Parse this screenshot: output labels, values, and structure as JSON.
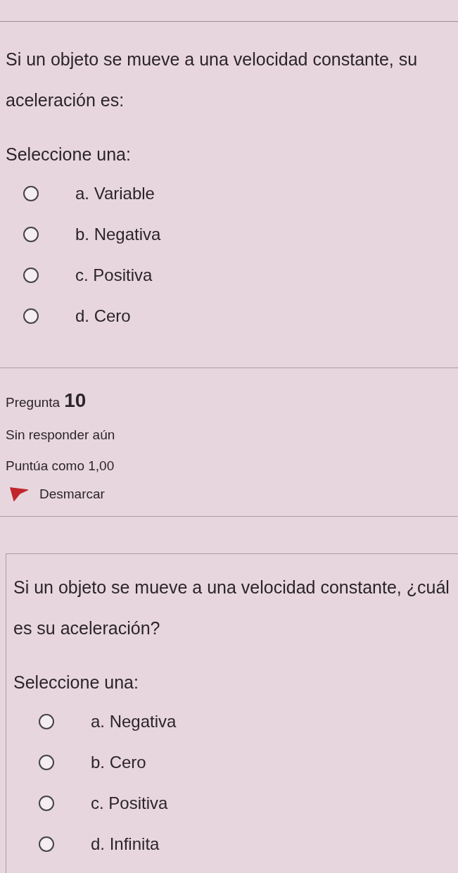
{
  "previous_question": {
    "text": "Si un objeto se mueve a una velocidad constante, su aceleración es:",
    "prompt": "Seleccione una:",
    "options": [
      {
        "label": "a. Variable",
        "selected": false
      },
      {
        "label": "b. Negativa",
        "selected": false
      },
      {
        "label": "c. Positiva",
        "selected": false
      },
      {
        "label": "d. Cero",
        "selected": false
      }
    ]
  },
  "question": {
    "title": "Pregunta",
    "number": "10",
    "status": "Sin responder aún",
    "score": "Puntúa como 1,00",
    "flagged": true,
    "flag_label": "Desmarcar",
    "text": "Si un objeto se mueve a una velocidad constante, ¿cuál es su aceleración?",
    "prompt": "Seleccione una:",
    "options": [
      {
        "label": "a. Negativa",
        "selected": false
      },
      {
        "label": "b. Cero",
        "selected": false
      },
      {
        "label": "c. Positiva",
        "selected": false
      },
      {
        "label": "d. Infinita",
        "selected": false
      }
    ]
  }
}
